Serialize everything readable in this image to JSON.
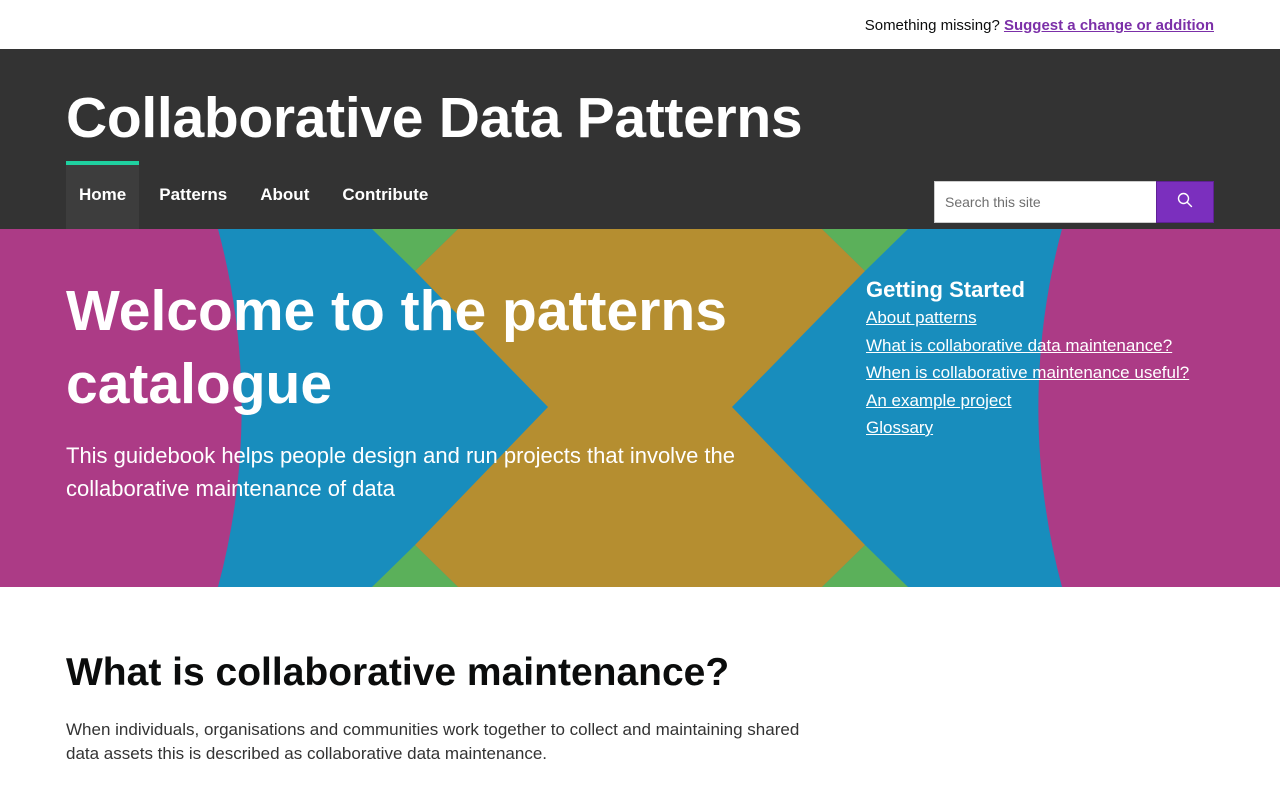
{
  "utility_bar": {
    "prompt": "Something missing?",
    "link_label": "Suggest a change or addition"
  },
  "header": {
    "site_title": "Collaborative Data Patterns",
    "nav": [
      {
        "label": "Home",
        "active": true
      },
      {
        "label": "Patterns",
        "active": false
      },
      {
        "label": "About",
        "active": false
      },
      {
        "label": "Contribute",
        "active": false
      }
    ],
    "search": {
      "placeholder": "Search this site",
      "value": "",
      "icon": "search-icon"
    }
  },
  "hero": {
    "title": "Welcome to the patterns catalogue",
    "subtitle": "This guidebook helps people design and run projects that involve the collaborative maintenance of data",
    "getting_started": {
      "title": "Getting Started",
      "links": [
        "About patterns",
        "What is collaborative data maintenance?",
        "When is collaborative maintenance useful?",
        "An example project",
        "Glossary"
      ]
    }
  },
  "main": {
    "title": "What is collaborative maintenance?",
    "text": "When individuals, organisations and communities work together to collect and maintaining shared data assets this is described as collaborative data maintenance."
  },
  "colors": {
    "header_bg": "#333333",
    "nav_active_accent": "#1fd1a0",
    "link_purple": "#7b2fa8",
    "search_button": "#7b2fbe",
    "hero_magenta": "#ac3b86",
    "hero_blue": "#188dbd",
    "hero_gold": "#b58e30",
    "hero_green": "#5bb05a"
  }
}
